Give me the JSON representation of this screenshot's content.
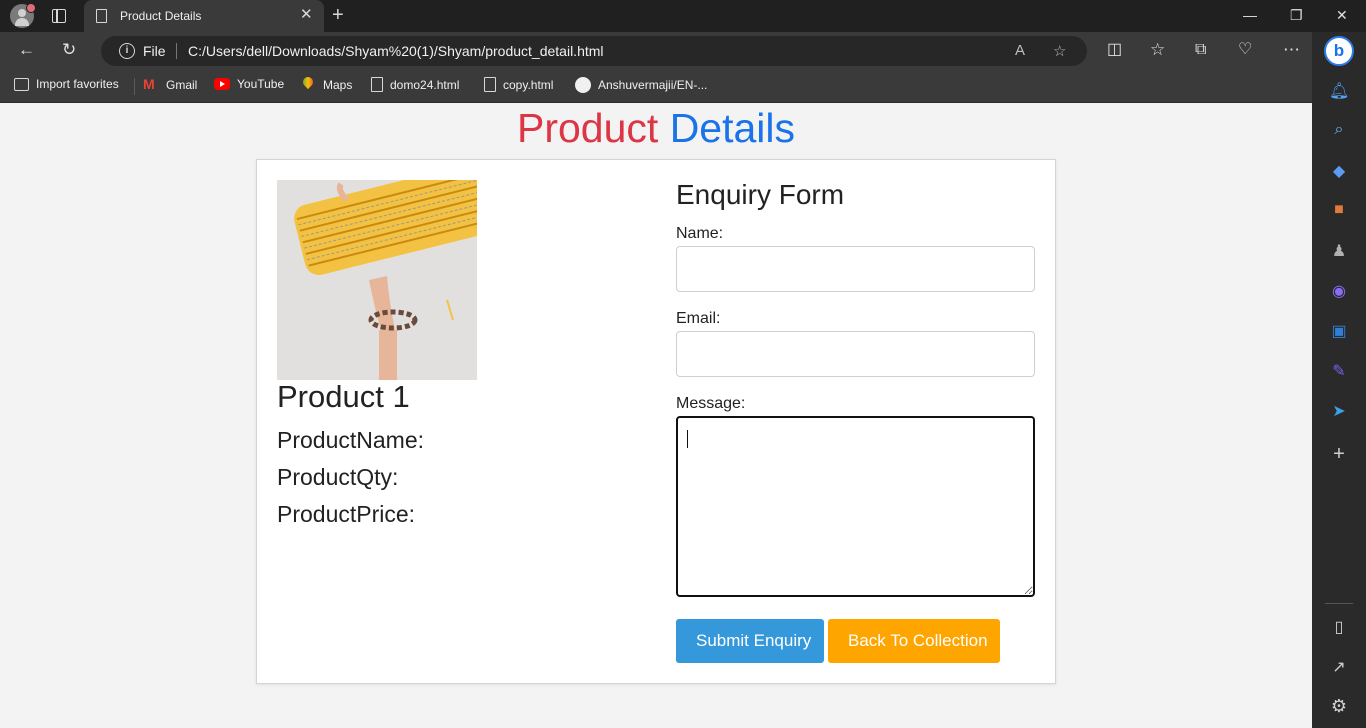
{
  "browser": {
    "tab_title": "Product Details",
    "tab_close": "✕",
    "new_tab": "+",
    "address_scheme": "File",
    "url": "C:/Users/dell/Downloads/Shyam%20(1)/Shyam/product_detail.html",
    "window_controls": {
      "minimize": "—",
      "maximize": "❐",
      "close": "✕"
    }
  },
  "favorites": [
    {
      "label": "Import favorites",
      "icon": "import-icon"
    },
    {
      "label": "Gmail",
      "icon": "gmail-icon"
    },
    {
      "label": "YouTube",
      "icon": "youtube-icon"
    },
    {
      "label": "Maps",
      "icon": "maps-icon"
    },
    {
      "label": "domo24.html",
      "icon": "page-icon"
    },
    {
      "label": "copy.html",
      "icon": "page-icon"
    },
    {
      "label": "Anshuvermajii/EN-...",
      "icon": "github-icon"
    }
  ],
  "page": {
    "title_part1": "Product",
    "title_part2": "Details",
    "product": {
      "heading": "Product 1",
      "name_label": "ProductName:",
      "qty_label": "ProductQty:",
      "price_label": "ProductPrice:"
    },
    "form": {
      "title": "Enquiry Form",
      "name_label": "Name:",
      "email_label": "Email:",
      "message_label": "Message:",
      "name_value": "",
      "email_value": "",
      "message_value": "",
      "submit_label": "Submit Enquiry",
      "back_label": "Back To Collection"
    }
  },
  "colors": {
    "title_red": "#dc3545",
    "title_blue": "#1a73e8",
    "submit_blue": "#3498db",
    "back_orange": "#ffa500"
  }
}
